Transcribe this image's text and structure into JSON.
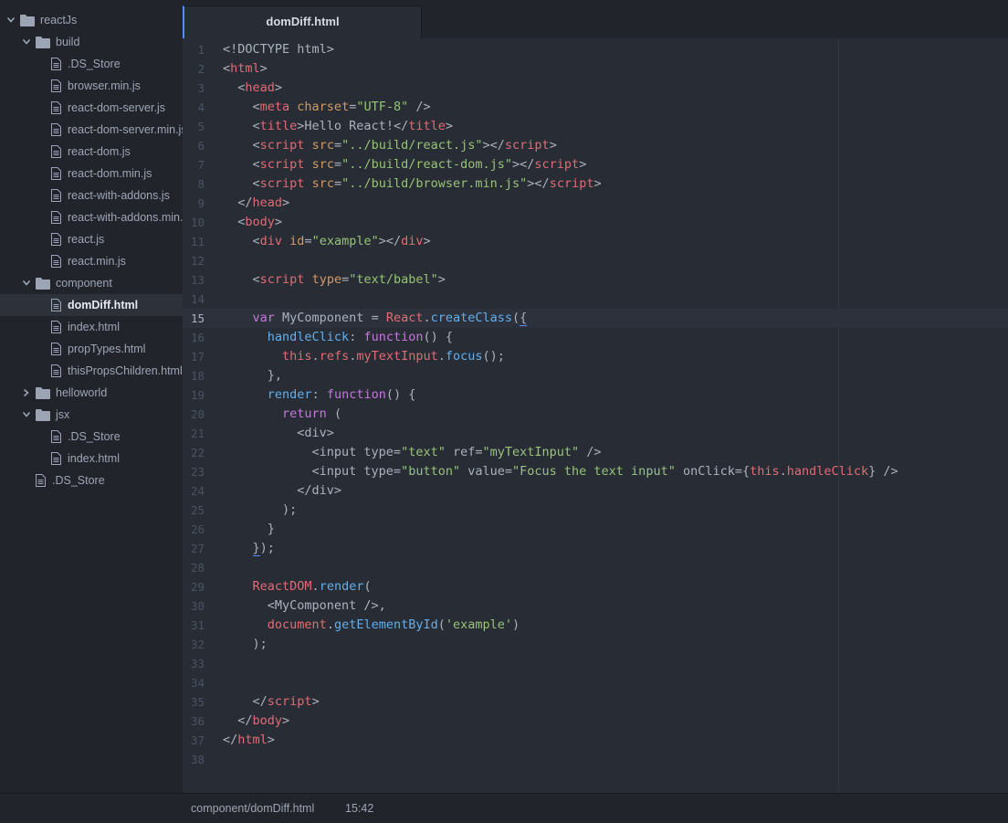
{
  "tab": {
    "title": "domDiff.html"
  },
  "status": {
    "path": "component/domDiff.html",
    "cursor": "15:42"
  },
  "tree": [
    {
      "label": "reactJs",
      "type": "folder",
      "depth": 0,
      "expanded": true
    },
    {
      "label": "build",
      "type": "folder",
      "depth": 1,
      "expanded": true
    },
    {
      "label": ".DS_Store",
      "type": "file",
      "depth": 2
    },
    {
      "label": "browser.min.js",
      "type": "file",
      "depth": 2
    },
    {
      "label": "react-dom-server.js",
      "type": "file",
      "depth": 2
    },
    {
      "label": "react-dom-server.min.js",
      "type": "file",
      "depth": 2
    },
    {
      "label": "react-dom.js",
      "type": "file",
      "depth": 2
    },
    {
      "label": "react-dom.min.js",
      "type": "file",
      "depth": 2
    },
    {
      "label": "react-with-addons.js",
      "type": "file",
      "depth": 2
    },
    {
      "label": "react-with-addons.min.js",
      "type": "file",
      "depth": 2
    },
    {
      "label": "react.js",
      "type": "file",
      "depth": 2
    },
    {
      "label": "react.min.js",
      "type": "file",
      "depth": 2
    },
    {
      "label": "component",
      "type": "folder",
      "depth": 1,
      "expanded": true
    },
    {
      "label": "domDiff.html",
      "type": "file",
      "depth": 2,
      "selected": true
    },
    {
      "label": "index.html",
      "type": "file",
      "depth": 2
    },
    {
      "label": "propTypes.html",
      "type": "file",
      "depth": 2
    },
    {
      "label": "thisPropsChildren.html",
      "type": "file",
      "depth": 2
    },
    {
      "label": "helloworld",
      "type": "folder",
      "depth": 1,
      "expanded": false
    },
    {
      "label": "jsx",
      "type": "folder",
      "depth": 1,
      "expanded": true
    },
    {
      "label": ".DS_Store",
      "type": "file",
      "depth": 2
    },
    {
      "label": "index.html",
      "type": "file",
      "depth": 2
    },
    {
      "label": ".DS_Store",
      "type": "file",
      "depth": 1
    }
  ],
  "editor": {
    "active_line": 15,
    "lines": [
      [
        [
          "t",
          "<!DOCTYPE html>"
        ]
      ],
      [
        [
          "t",
          "<"
        ],
        [
          "g",
          "html"
        ],
        [
          "t",
          ">"
        ]
      ],
      [
        [
          "t",
          "  <"
        ],
        [
          "g",
          "head"
        ],
        [
          "t",
          ">"
        ]
      ],
      [
        [
          "t",
          "    <"
        ],
        [
          "g",
          "meta"
        ],
        [
          "t",
          " "
        ],
        [
          "a",
          "charset"
        ],
        [
          "t",
          "="
        ],
        [
          "s",
          "\"UTF-8\""
        ],
        [
          "t",
          " />"
        ]
      ],
      [
        [
          "t",
          "    <"
        ],
        [
          "g",
          "title"
        ],
        [
          "t",
          ">Hello React!</"
        ],
        [
          "g",
          "title"
        ],
        [
          "t",
          ">"
        ]
      ],
      [
        [
          "t",
          "    <"
        ],
        [
          "g",
          "script"
        ],
        [
          "t",
          " "
        ],
        [
          "a",
          "src"
        ],
        [
          "t",
          "="
        ],
        [
          "s",
          "\"../build/react.js\""
        ],
        [
          "t",
          "></"
        ],
        [
          "g",
          "script"
        ],
        [
          "t",
          ">"
        ]
      ],
      [
        [
          "t",
          "    <"
        ],
        [
          "g",
          "script"
        ],
        [
          "t",
          " "
        ],
        [
          "a",
          "src"
        ],
        [
          "t",
          "="
        ],
        [
          "s",
          "\"../build/react-dom.js\""
        ],
        [
          "t",
          "></"
        ],
        [
          "g",
          "script"
        ],
        [
          "t",
          ">"
        ]
      ],
      [
        [
          "t",
          "    <"
        ],
        [
          "g",
          "script"
        ],
        [
          "t",
          " "
        ],
        [
          "a",
          "src"
        ],
        [
          "t",
          "="
        ],
        [
          "s",
          "\"../build/browser.min.js\""
        ],
        [
          "t",
          "></"
        ],
        [
          "g",
          "script"
        ],
        [
          "t",
          ">"
        ]
      ],
      [
        [
          "t",
          "  </"
        ],
        [
          "g",
          "head"
        ],
        [
          "t",
          ">"
        ]
      ],
      [
        [
          "t",
          "  <"
        ],
        [
          "g",
          "body"
        ],
        [
          "t",
          ">"
        ]
      ],
      [
        [
          "t",
          "    <"
        ],
        [
          "g",
          "div"
        ],
        [
          "t",
          " "
        ],
        [
          "a",
          "id"
        ],
        [
          "t",
          "="
        ],
        [
          "s",
          "\"example\""
        ],
        [
          "t",
          "></"
        ],
        [
          "g",
          "div"
        ],
        [
          "t",
          ">"
        ]
      ],
      [],
      [
        [
          "t",
          "    <"
        ],
        [
          "g",
          "script"
        ],
        [
          "t",
          " "
        ],
        [
          "a",
          "type"
        ],
        [
          "t",
          "="
        ],
        [
          "s",
          "\"text/babel\""
        ],
        [
          "t",
          ">"
        ]
      ],
      [],
      [
        [
          "t",
          "    "
        ],
        [
          "k",
          "var"
        ],
        [
          "t",
          " MyComponent = "
        ],
        [
          "g",
          "React"
        ],
        [
          "t",
          "."
        ],
        [
          "f",
          "createClass"
        ],
        [
          "t",
          "("
        ],
        [
          "b",
          "{"
        ]
      ],
      [
        [
          "t",
          "      "
        ],
        [
          "f",
          "handleClick"
        ],
        [
          "t",
          ": "
        ],
        [
          "k",
          "function"
        ],
        [
          "t",
          "() {"
        ]
      ],
      [
        [
          "t",
          "        "
        ],
        [
          "g",
          "this"
        ],
        [
          "t",
          "."
        ],
        [
          "g",
          "refs"
        ],
        [
          "t",
          "."
        ],
        [
          "g",
          "myTextInput"
        ],
        [
          "t",
          "."
        ],
        [
          "f",
          "focus"
        ],
        [
          "t",
          "();"
        ]
      ],
      [
        [
          "t",
          "      },"
        ]
      ],
      [
        [
          "t",
          "      "
        ],
        [
          "f",
          "render"
        ],
        [
          "t",
          ": "
        ],
        [
          "k",
          "function"
        ],
        [
          "t",
          "() {"
        ]
      ],
      [
        [
          "t",
          "        "
        ],
        [
          "k",
          "return"
        ],
        [
          "t",
          " ("
        ]
      ],
      [
        [
          "t",
          "          <div>"
        ]
      ],
      [
        [
          "t",
          "            <input type="
        ],
        [
          "s",
          "\"text\""
        ],
        [
          "t",
          " ref="
        ],
        [
          "s",
          "\"myTextInput\""
        ],
        [
          "t",
          " />"
        ]
      ],
      [
        [
          "t",
          "            <input type="
        ],
        [
          "s",
          "\"button\""
        ],
        [
          "t",
          " value="
        ],
        [
          "s",
          "\"Focus the text input\""
        ],
        [
          "t",
          " onClick={"
        ],
        [
          "g",
          "this"
        ],
        [
          "t",
          "."
        ],
        [
          "g",
          "handleClick"
        ],
        [
          "t",
          "} />"
        ]
      ],
      [
        [
          "t",
          "          </div>"
        ]
      ],
      [
        [
          "t",
          "        );"
        ]
      ],
      [
        [
          "t",
          "      }"
        ]
      ],
      [
        [
          "t",
          "    "
        ],
        [
          "b",
          "}"
        ],
        [
          "t",
          ");"
        ]
      ],
      [],
      [
        [
          "t",
          "    "
        ],
        [
          "g",
          "ReactDOM"
        ],
        [
          "t",
          "."
        ],
        [
          "f",
          "render"
        ],
        [
          "t",
          "("
        ]
      ],
      [
        [
          "t",
          "      <MyComponent />,"
        ]
      ],
      [
        [
          "t",
          "      "
        ],
        [
          "g",
          "document"
        ],
        [
          "t",
          "."
        ],
        [
          "f",
          "getElementById"
        ],
        [
          "t",
          "("
        ],
        [
          "s",
          "'example'"
        ],
        [
          "t",
          ")"
        ]
      ],
      [
        [
          "t",
          "    );"
        ]
      ],
      [],
      [],
      [
        [
          "t",
          "    </"
        ],
        [
          "g",
          "script"
        ],
        [
          "t",
          ">"
        ]
      ],
      [
        [
          "t",
          "  </"
        ],
        [
          "g",
          "body"
        ],
        [
          "t",
          ">"
        ]
      ],
      [
        [
          "t",
          "</"
        ],
        [
          "g",
          "html"
        ],
        [
          "t",
          ">"
        ]
      ],
      []
    ]
  }
}
